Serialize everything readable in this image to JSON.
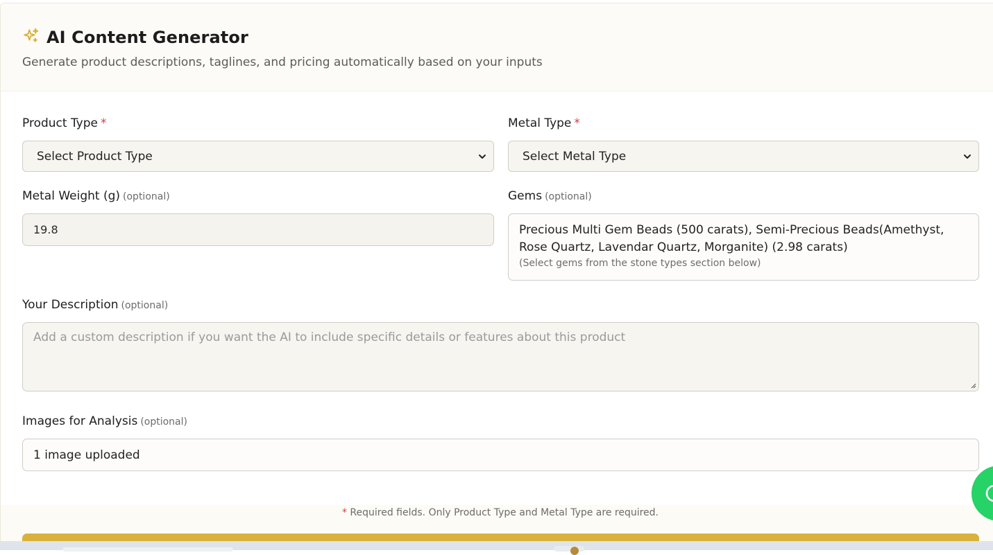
{
  "header": {
    "title": "AI Content Generator",
    "subtitle": "Generate product descriptions, taglines, and pricing automatically based on your inputs",
    "icon": "sparkles-icon",
    "accent": "#d9b23c"
  },
  "form": {
    "product_type": {
      "label": "Product Type",
      "required_mark": "*",
      "selected": "Select Product Type"
    },
    "metal_type": {
      "label": "Metal Type",
      "required_mark": "*",
      "selected": "Select Metal Type"
    },
    "metal_weight": {
      "label": "Metal Weight (g)",
      "optional": "(optional)",
      "value": "19.8"
    },
    "gems": {
      "label": "Gems",
      "optional": "(optional)",
      "value": "Precious Multi Gem Beads (500 carats), Semi-Precious Beads(Amethyst, Rose Quartz, Lavendar Quartz, Morganite) (2.98 carats)",
      "hint": "(Select gems from the stone types section below)"
    },
    "description": {
      "label": "Your Description",
      "optional": "(optional)",
      "placeholder": "Add a custom description if you want the AI to include specific details or features about this product"
    },
    "images": {
      "label": "Images for Analysis",
      "optional": "(optional)",
      "value": "1 image uploaded"
    }
  },
  "footer": {
    "required_star": "*",
    "note": " Required fields. Only Product Type and Metal Type are required."
  },
  "widgets": {
    "chat_icon": "whatsapp-icon",
    "chat_color": "#25d366"
  }
}
